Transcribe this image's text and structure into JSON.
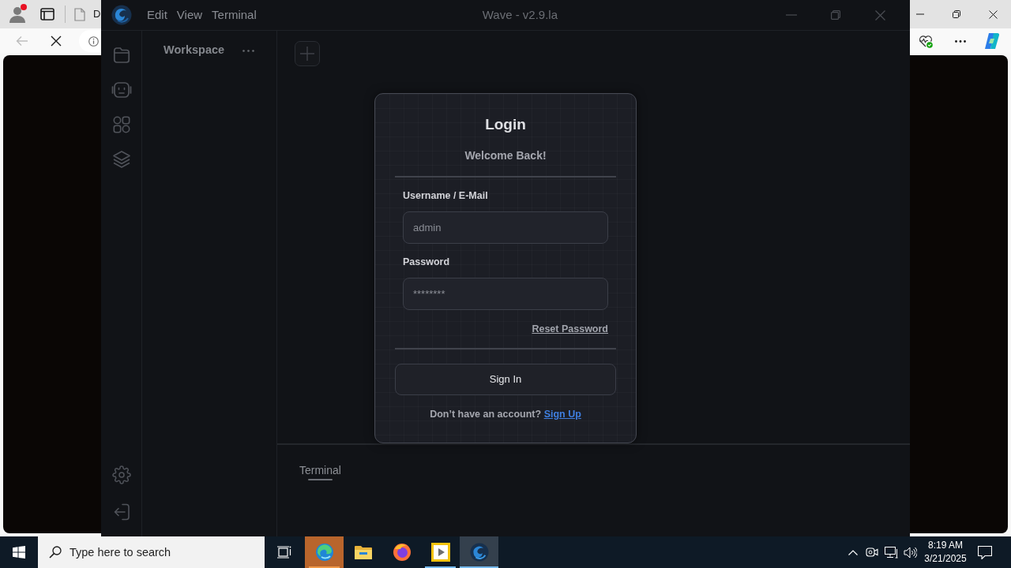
{
  "browser": {
    "tab": {
      "title": "D"
    },
    "back_button": {
      "disabled": true
    }
  },
  "app": {
    "title": "Wave - v2.9.la",
    "menu": [
      "Edit",
      "View",
      "Terminal"
    ],
    "workspace": {
      "title": "Workspace"
    },
    "terminal_panel": {
      "tabs": [
        {
          "label": "Terminal",
          "selected": true
        }
      ]
    }
  },
  "login": {
    "title": "Login",
    "subtitle": "Welcome Back!",
    "fields": [
      {
        "label": "Username / E-Mail",
        "placeholder": "admin"
      },
      {
        "label": "Password",
        "placeholder": "********"
      }
    ],
    "reset_link": "Reset Password",
    "submit_button": "Sign In",
    "signup_prompt": "Don’t have an account?",
    "signup_link": "Sign Up"
  },
  "taskbar": {
    "search": {
      "placeholder": "Type here to search"
    },
    "apps": [
      {
        "flashing": true,
        "running": true,
        "selected": false
      },
      {
        "flashing": false,
        "running": false,
        "selected": false
      },
      {
        "flashing": false,
        "running": false,
        "selected": false
      },
      {
        "flashing": false,
        "running": true,
        "selected": false
      },
      {
        "flashing": false,
        "running": true,
        "selected": true
      }
    ],
    "clock": {
      "time": "8:19 AM",
      "date": "3/21/2025"
    }
  }
}
